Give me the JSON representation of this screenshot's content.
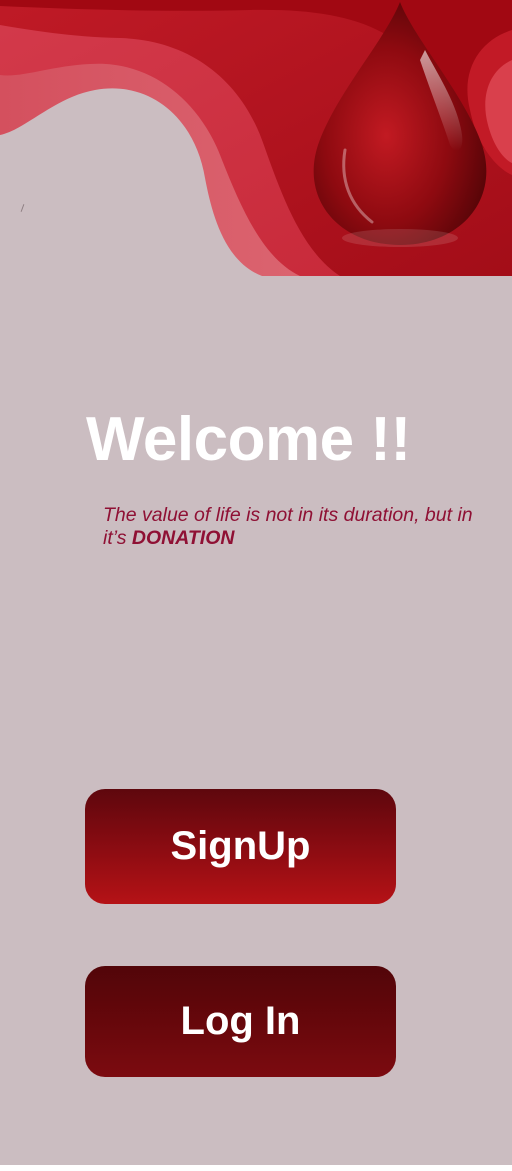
{
  "welcome": {
    "title": "Welcome !!",
    "tagline_prefix": "The value of life is not in its duration, but in it’s",
    "tagline_emphasis": "DONATION"
  },
  "actions": {
    "signup_label": "SignUp",
    "login_label": "Log In"
  },
  "theme": {
    "background": "#cbbdc1",
    "accent": "#b51216",
    "tagline_color": "#8f1034"
  },
  "icons": [
    "blood-drop-icon"
  ]
}
